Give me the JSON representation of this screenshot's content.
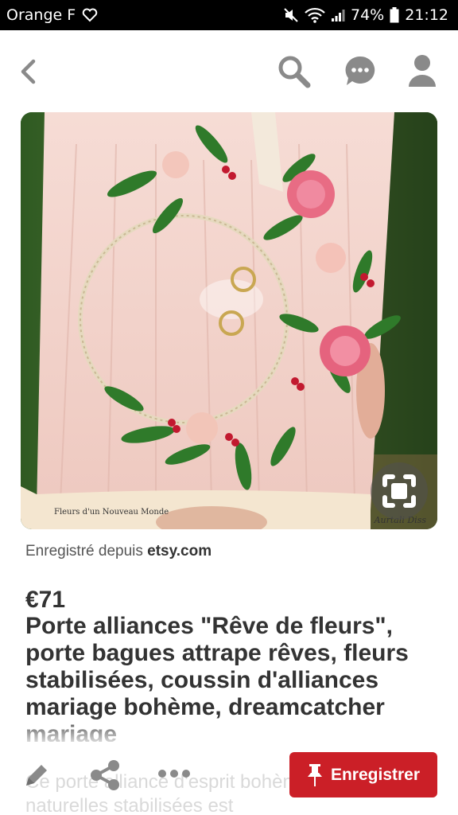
{
  "status_bar": {
    "carrier": "Orange F",
    "battery": "74%",
    "time": "21:12"
  },
  "header": {
    "icons": [
      "back-arrow-icon",
      "search-icon",
      "chat-icon",
      "user-icon"
    ]
  },
  "pin": {
    "watermark_left": "Fleurs d'un Nouveau Monde",
    "watermark_right": "Aurtali Diss",
    "saved_from_label": "Enregistré depuis",
    "saved_from_domain": "etsy.com",
    "price": "€71",
    "title": "Porte alliances \"Rêve de fleurs\", porte bagues attrape rêves, fleurs stabilisées, coussin d'alliances mariage bohème, dreamcatcher mariage",
    "description": "Ce porte alliance d'esprit bohème orné de fleurs naturelles stabilisées est"
  },
  "actions": {
    "save_label": "Enregistrer"
  },
  "colors": {
    "save_button": "#cb1f27",
    "icon_grey": "#8a8a8a",
    "text_dark": "#333333"
  }
}
